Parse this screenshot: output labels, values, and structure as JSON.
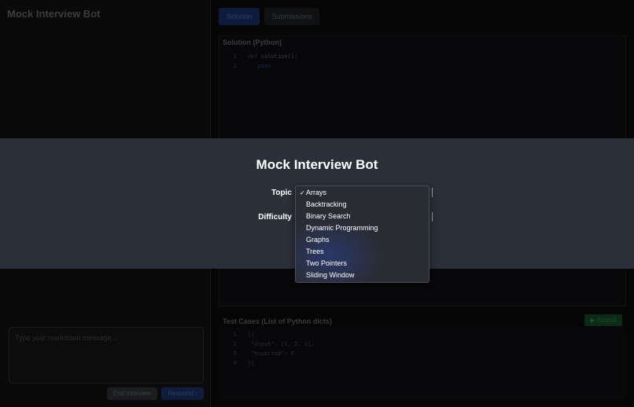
{
  "app": {
    "title": "Mock Interview Bot"
  },
  "chat": {
    "placeholder": "Type your markdown message...",
    "end_label": "End Interview",
    "respond_label": "Respond ›"
  },
  "tabs": [
    {
      "label": "Solution",
      "active": true
    },
    {
      "label": "Submissions",
      "active": false
    }
  ],
  "editor": {
    "title": "Solution (Python)",
    "lines": [
      {
        "n": "1",
        "kw": "def",
        "text": "solution():"
      },
      {
        "n": "2",
        "kw": "pass",
        "text": ""
      }
    ]
  },
  "tests": {
    "title": "Test Cases (List of Python dicts)",
    "submit_label": "▶ Submit",
    "lines": [
      {
        "n": "1",
        "text": "[{"
      },
      {
        "n": "2",
        "text": "  \"input\": [1, 2, 3],"
      },
      {
        "n": "3",
        "text": "  \"expected\": 6"
      },
      {
        "n": "4",
        "text": "}]"
      }
    ]
  },
  "modal": {
    "title": "Mock Interview Bot",
    "topic_label": "Topic",
    "difficulty_label": "Difficulty",
    "topic_options": [
      {
        "label": "Arrays",
        "selected": true
      },
      {
        "label": "Backtracking",
        "selected": false
      },
      {
        "label": "Binary Search",
        "selected": false
      },
      {
        "label": "Dynamic Programming",
        "selected": false
      },
      {
        "label": "Graphs",
        "selected": false
      },
      {
        "label": "Trees",
        "selected": false
      },
      {
        "label": "Two Pointers",
        "selected": false
      },
      {
        "label": "Sliding Window",
        "selected": false
      }
    ],
    "check_mark": "✓"
  },
  "colors": {
    "modal_band": "#2a2f3a",
    "dropdown_bg": "#2a2c34",
    "accent": "#1f4fd1"
  }
}
